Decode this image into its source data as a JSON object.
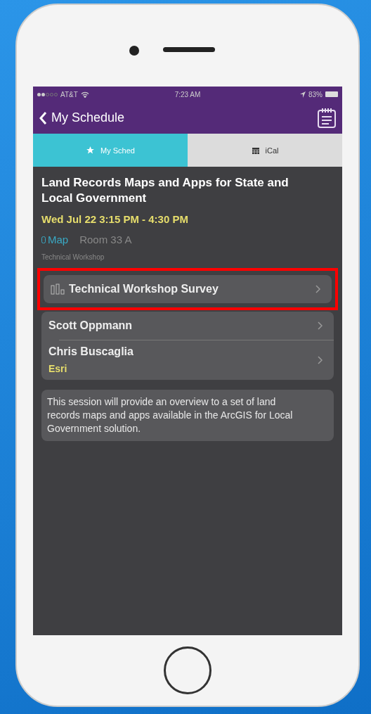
{
  "status_bar": {
    "carrier": "AT&T",
    "time": "7:23 AM",
    "battery": "83%"
  },
  "nav": {
    "back_label": "My Schedule"
  },
  "tabs": [
    {
      "label": "My Sched",
      "kind": "star",
      "selected": true
    },
    {
      "label": "iCal",
      "kind": "calendar",
      "selected": false
    }
  ],
  "session": {
    "title": "Land Records Maps and Apps for State and Local Government",
    "time": "Wed Jul 22 3:15 PM - 4:30 PM",
    "map_link": "Map",
    "room": "Room 33 A",
    "type": "Technical Workshop"
  },
  "survey": {
    "label": "Technical Workshop Survey",
    "highlighted": true
  },
  "speakers": [
    {
      "name": "Scott Oppmann"
    },
    {
      "name": "Chris Buscaglia",
      "organization": "Esri"
    }
  ],
  "description": "This session will provide an overview to a set of land records maps and apps available in the ArcGIS for Local Government solution."
}
